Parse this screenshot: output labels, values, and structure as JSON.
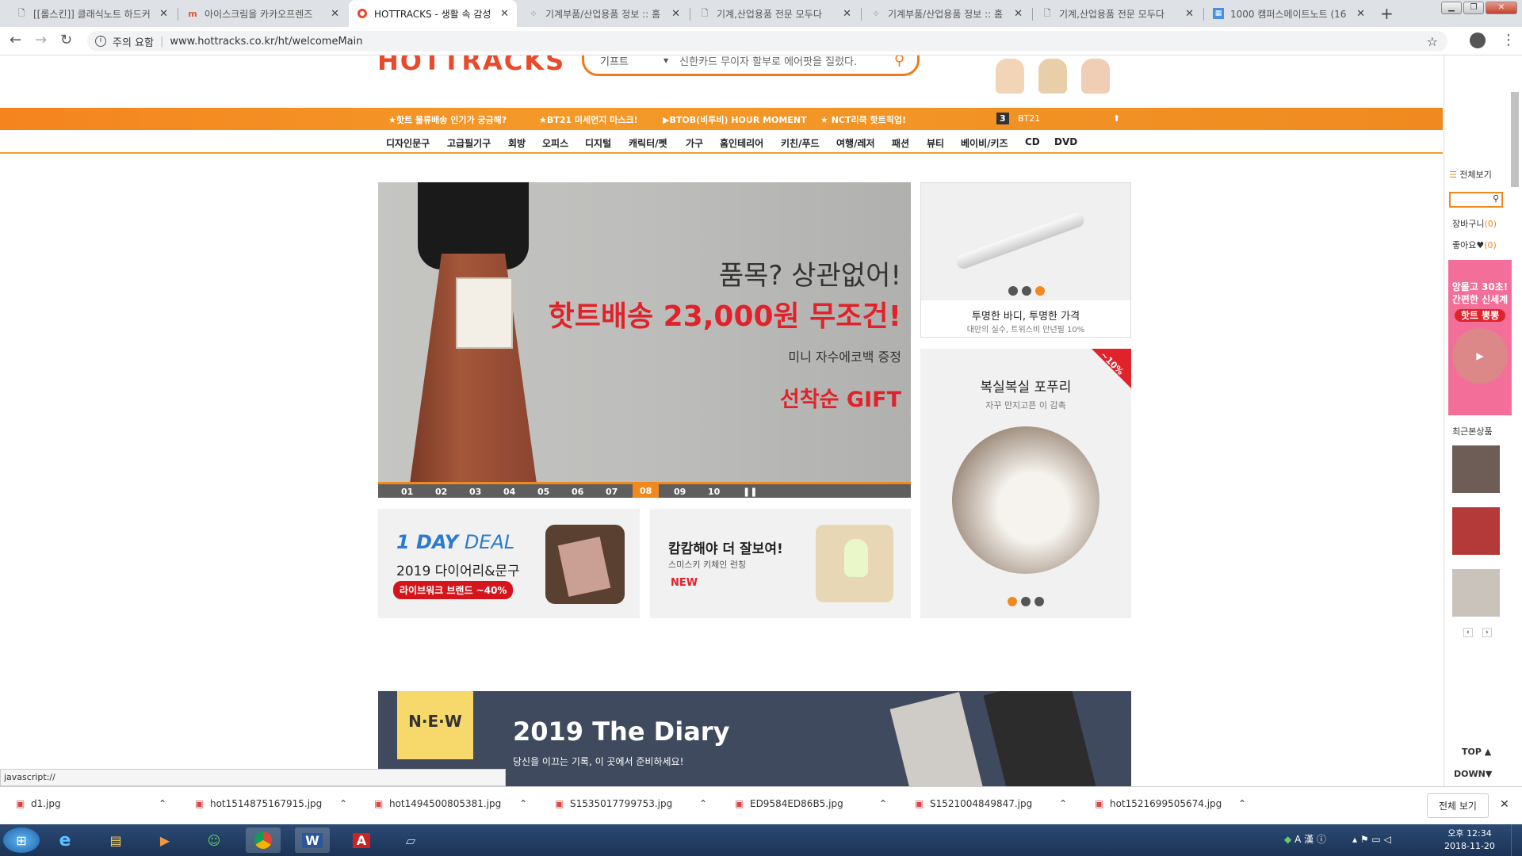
{
  "browser": {
    "tabs": [
      {
        "title": "[[롤스킨]] 클래식노트 하드커"
      },
      {
        "title": "아이스크림을 카카오프렌즈"
      },
      {
        "title": "HOTTRACKS - 생활 속 감성"
      },
      {
        "title": "기계부품/산업용품 정보 :: 홈"
      },
      {
        "title": "기계,산업용품 전문 모두다"
      },
      {
        "title": "기계부품/산업용품 정보 :: 홈"
      },
      {
        "title": "기계,산업용품 전문 모두다"
      },
      {
        "title": "1000 캠퍼스메이트노트 (16"
      }
    ],
    "security_label": "주의 요함",
    "url": "www.hottracks.co.kr/ht/welcomeMain",
    "status_url": "javascript://"
  },
  "site": {
    "logo": "HOTTRACKS",
    "search": {
      "category": "기프트",
      "placeholder": "신한카드 무이자 할부로 에어팟을 질렀다."
    },
    "ticker": [
      "★핫트 물류배송 인기가 궁금해?",
      "★BT21 미세먼지 마스크!",
      "▶BTOB(비투비) HOUR MOMENT",
      "★ NCT리쿡 핫트픽업!"
    ],
    "rank": {
      "num": "3",
      "label": "BT21"
    },
    "categories": [
      "디자인문구",
      "고급필기구",
      "회방",
      "오피스",
      "디지털",
      "캐릭터/펫",
      "가구",
      "홈인테리어",
      "키친/푸드",
      "여행/레저",
      "패션",
      "뷰티",
      "베이비/키즈",
      "CD",
      "DVD"
    ],
    "hero": {
      "line1": "품목? 상관없어!",
      "line2": "핫트배송 23,000원 무조건!",
      "line3": "미니 자수에코백 증정",
      "line4": "선착순 GIFT",
      "slides": [
        "01",
        "02",
        "03",
        "04",
        "05",
        "06",
        "07",
        "08",
        "09",
        "10"
      ],
      "active_slide": "08"
    },
    "deal": {
      "title_a": "1 DAY",
      "title_b": "DEAL",
      "subtitle": "2019 다이어리&문구",
      "badge": "라이브워크 브랜드 ~40%"
    },
    "keychain": {
      "title": "캄캄해야 더 잘보여!",
      "subtitle": "스미스키 키체인 런칭",
      "tag": "NEW"
    },
    "pen": {
      "title": "투명한 바디, 투명한 가격",
      "subtitle": "대만의 실수, 트위스비 만년필 10%"
    },
    "pouch": {
      "title": "복실복실 포푸리",
      "subtitle": "자꾸 만지고픈 이 감촉",
      "badge": "~10%"
    },
    "diary": {
      "tag": "N·E·W",
      "title_a": "2019 The ",
      "title_b": "Diary",
      "subtitle": "당신을 이끄는 기록, 이 곳에서 준비하세요!"
    }
  },
  "sidebar": {
    "all_view": "전체보기",
    "cart": "장바구니",
    "cart_count": "(0)",
    "like": "좋아요♥",
    "like_count": "(0)",
    "ad": {
      "line1": "앙몰고 30초!",
      "line2": "간편한 신세계",
      "line3": "핫트 뽕뽕"
    },
    "recent": "최근본상품",
    "top": "TOP ▲",
    "down": "DOWN▼"
  },
  "downloads": {
    "files": [
      "d1.jpg",
      "hot1514875167915.jpg",
      "hot1494500805381.jpg",
      "S1535017799753.jpg",
      "ED9584ED86B5.jpg",
      "S1521004849847.jpg",
      "hot1521699505674.jpg"
    ],
    "show_all": "전체 보기"
  },
  "taskbar": {
    "ime": "A 漢",
    "time": "오후 12:34",
    "date": "2018-11-20"
  },
  "colors": {
    "brand_orange": "#f5841e",
    "hero_red": "#e0232a",
    "deal_blue": "#2a7bd0",
    "diary_bg": "#3f4a5e"
  }
}
